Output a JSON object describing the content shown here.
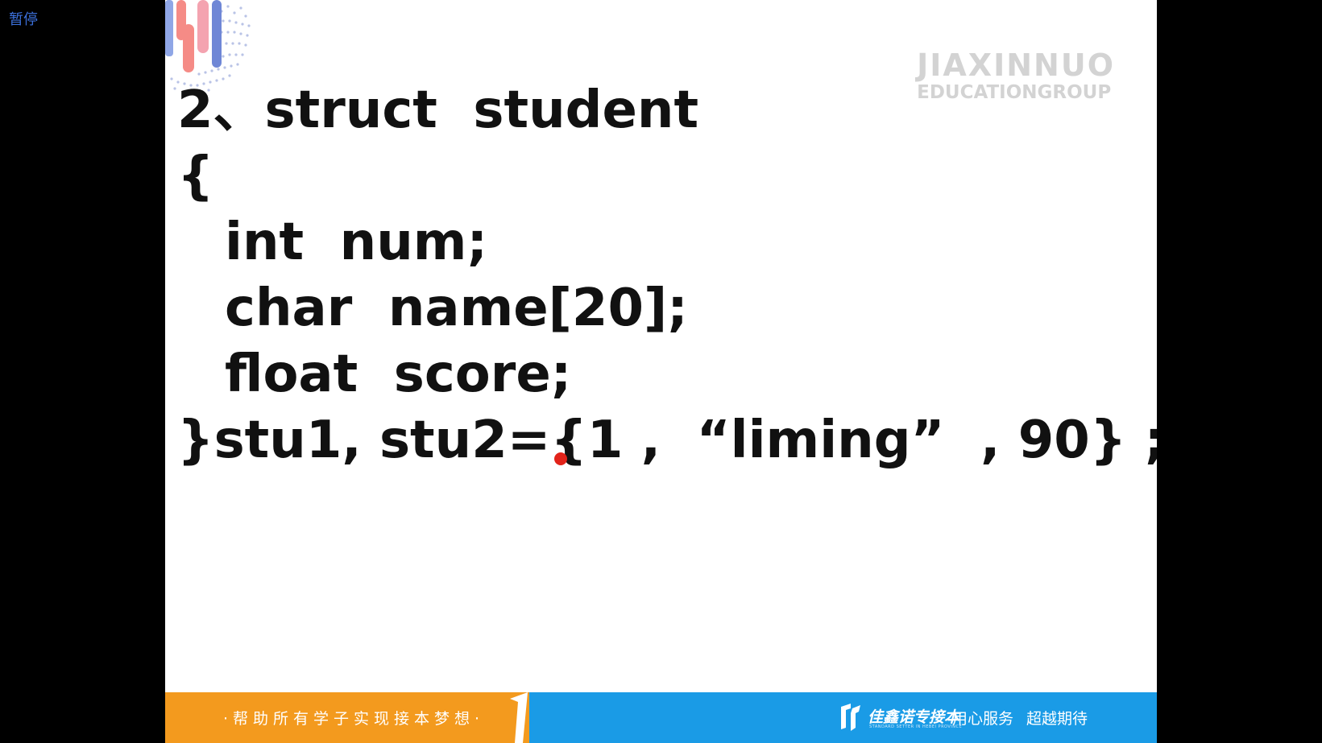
{
  "player": {
    "pause_label": "暂停"
  },
  "slide": {
    "watermark": {
      "line1": "JIAXINNUO",
      "line2": "EDUCATIONGROUP"
    },
    "code_lines": [
      "2、struct  student",
      "{",
      "int  num;",
      "char  name[20];",
      "float  score;",
      "}stu1, stu2={1 ,  “liming”  , 90} ;"
    ],
    "footer": {
      "slogan": "·帮助所有学子实现接本梦想·",
      "brand_name": "佳鑫诺专接本",
      "brand_sub": "STANDARD SETTER IN HEBEI PROVINCE",
      "tagline": "用心服务 超越期待"
    }
  },
  "colors": {
    "pause_text": "#3b6fd9",
    "footer_orange": "#f39a1e",
    "footer_blue": "#1a9be6",
    "pointer": "#e2231a",
    "watermark": "#d3d3d3"
  }
}
